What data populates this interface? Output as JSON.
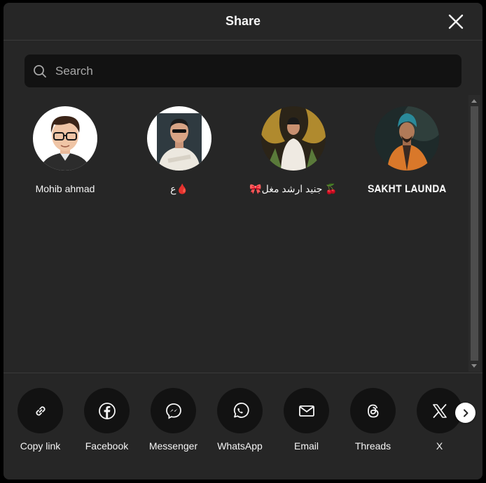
{
  "header": {
    "title": "Share",
    "close_icon": "close-icon"
  },
  "search": {
    "placeholder": "Search",
    "value": ""
  },
  "contacts": [
    {
      "name": "Mohib ahmad"
    },
    {
      "name": "ع🩸"
    },
    {
      "name": "🎀جنید ارشد مغل 🍒"
    },
    {
      "name": "𝐒𝐀𝐊𝐇𝐓 𝐋𝐀𝐔𝐍𝐃𝐀"
    }
  ],
  "share_options": [
    {
      "label": "Copy link",
      "icon": "link-icon"
    },
    {
      "label": "Facebook",
      "icon": "facebook-icon"
    },
    {
      "label": "Messenger",
      "icon": "messenger-icon"
    },
    {
      "label": "WhatsApp",
      "icon": "whatsapp-icon"
    },
    {
      "label": "Email",
      "icon": "email-icon"
    },
    {
      "label": "Threads",
      "icon": "threads-icon"
    },
    {
      "label": "X",
      "icon": "x-icon"
    }
  ],
  "colors": {
    "modal_bg": "#262626",
    "search_bg": "#121212",
    "text": "#f5f5f5",
    "placeholder": "#a8a8a8"
  }
}
